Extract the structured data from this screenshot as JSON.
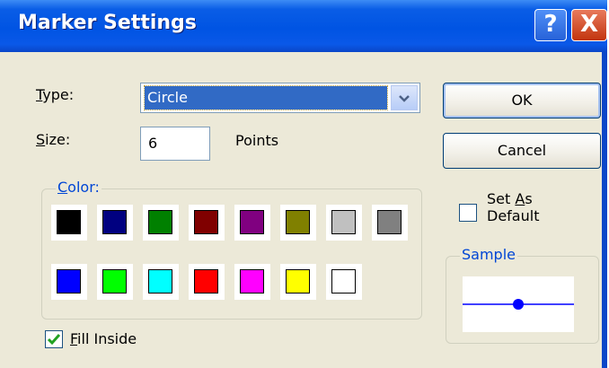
{
  "window": {
    "title": "Marker Settings",
    "help_glyph": "?",
    "close_glyph": "X",
    "title_bar_color": "#0054e3"
  },
  "type_field": {
    "label_first": "T",
    "label_rest": "ype:",
    "value": "Circle"
  },
  "size_field": {
    "label_first": "S",
    "label_rest": "ize:",
    "value": "6",
    "unit": "Points"
  },
  "buttons": {
    "ok": "OK",
    "cancel": "Cancel"
  },
  "color_group": {
    "label_first": "C",
    "label_rest": "olor:",
    "swatches": [
      "#000000",
      "#000080",
      "#008000",
      "#800000",
      "#800080",
      "#808000",
      "#c0c0c0",
      "#808080",
      "#0000ff",
      "#00ff00",
      "#00ffff",
      "#ff0000",
      "#ff00ff",
      "#ffff00",
      "#ffffff"
    ]
  },
  "fill_inside": {
    "label_first": "F",
    "label_rest": "ill Inside",
    "checked": true
  },
  "set_as_default": {
    "line1": "Set ",
    "line1_u": "A",
    "line1_rest": "s",
    "line2": "Default",
    "checked": false
  },
  "sample": {
    "label": "Sample",
    "line_color": "#0000ff",
    "marker_color": "#0000ff"
  }
}
